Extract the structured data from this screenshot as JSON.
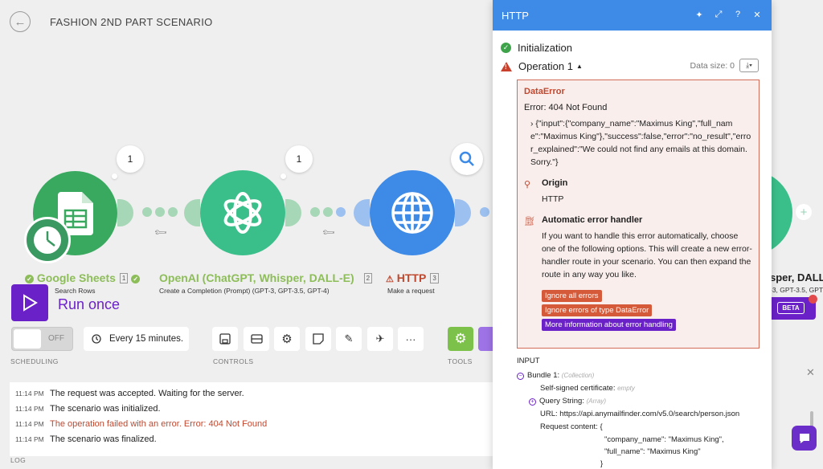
{
  "header": {
    "title": "FASHION 2ND PART SCENARIO"
  },
  "nodes": [
    {
      "title": "Google Sheets",
      "num": "1",
      "sub": "Search Rows",
      "bubble": "1"
    },
    {
      "title": "OpenAI (ChatGPT, Whisper, DALL-E)",
      "num": "2",
      "sub": "Create a Completion (Prompt) (GPT-3, GPT-3.5, GPT-4)",
      "bubble": "1"
    },
    {
      "title": "HTTP",
      "num": "3",
      "sub": "Make a request"
    },
    {
      "title": "sper, DALL-",
      "sub": "-3, GPT-3.5, GPT-"
    }
  ],
  "controls": {
    "run_once": "Run once",
    "toggle": "OFF",
    "schedule": "Every 15 minutes.",
    "scheduling_label": "SCHEDULING",
    "controls_label": "CONTROLS",
    "tools_label": "TOOLS",
    "beta": "BETA"
  },
  "log": {
    "label": "LOG",
    "rows": [
      {
        "time": "11:14 PM",
        "msg": "The request was accepted. Waiting for the server."
      },
      {
        "time": "11:14 PM",
        "msg": "The scenario was initialized."
      },
      {
        "time": "11:14 PM",
        "msg": "The operation failed with an error. Error: 404 Not Found"
      },
      {
        "time": "11:14 PM",
        "msg": "The scenario was finalized."
      }
    ]
  },
  "panel": {
    "title": "HTTP",
    "initialization": "Initialization",
    "operation": "Operation 1",
    "data_size": "Data size: 0",
    "error": {
      "type": "DataError",
      "message": "Error: 404 Not Found",
      "json": "{\"input\":{\"company_name\":\"Maximus King\",\"full_name\":\"Maximus King\"},\"success\":false,\"error\":\"no_result\",\"error_explained\":\"We could not find any emails at this domain. Sorry.\"}",
      "origin_label": "Origin",
      "origin_value": "HTTP",
      "handler_label": "Automatic error handler",
      "handler_text": "If you want to handle this error automatically, choose one of the following options. This will create a new error-handler route in your scenario. You can then expand the route in any way you like.",
      "btn_ignore_all": "Ignore all errors",
      "btn_ignore_type": "Ignore errors of type DataError",
      "btn_more": "More information about error handling"
    },
    "input": {
      "heading": "INPUT",
      "bundle": "Bundle 1:",
      "bundle_type": "(Collection)",
      "cert_label": "Self-signed certificate:",
      "cert_value": "empty",
      "query_label": "Query String:",
      "query_type": "(Array)",
      "url_label": "URL:",
      "url_value": "https://api.anymailfinder.com/v5.0/search/person.json",
      "content_label": "Request content:",
      "content_open": "{",
      "content_line1": "\"company_name\": \"Maximus King\",",
      "content_line2": "\"full_name\": \"Maximus King\"",
      "content_close": "}"
    }
  },
  "colors": {
    "accent": "#6b21c8",
    "http_blue": "#3d8ae7",
    "sheets_green": "#34a853",
    "openai_green": "#3bbf8a",
    "error_red": "#c0482f"
  }
}
